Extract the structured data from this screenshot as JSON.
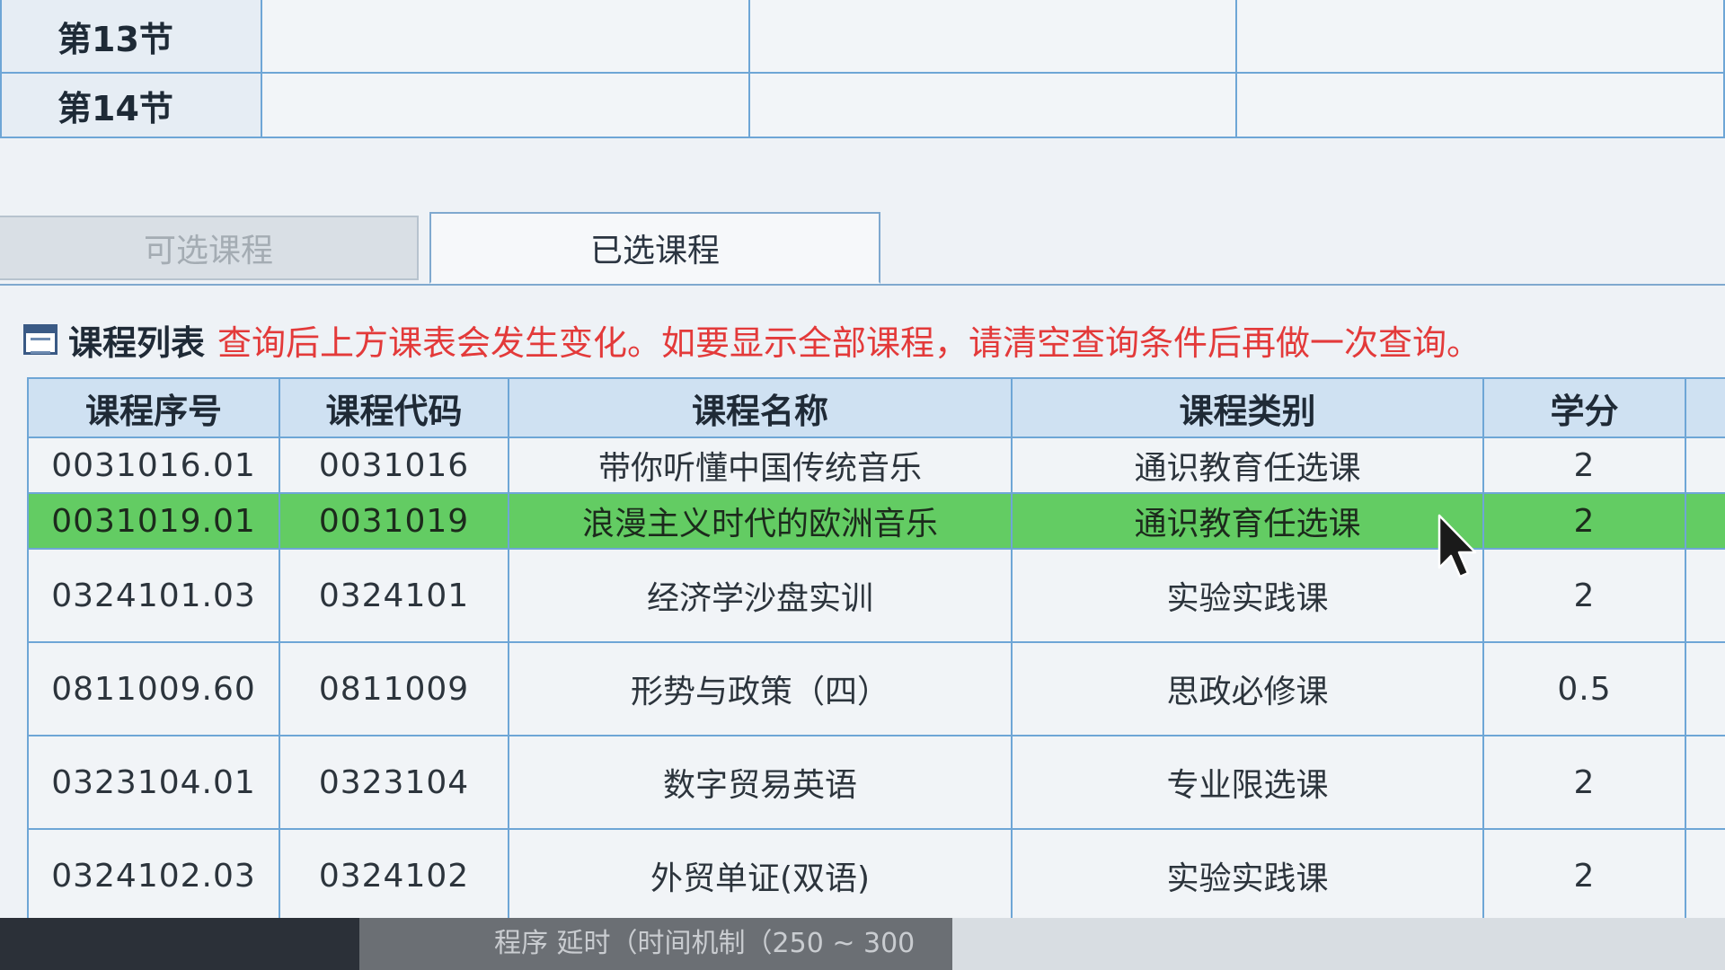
{
  "timetable": {
    "periods": [
      "第13节",
      "第14节"
    ]
  },
  "tabs": {
    "available_label": "可选课程",
    "selected_label": "已选课程"
  },
  "panel": {
    "title": "课程列表",
    "notice": "查询后上方课表会发生变化。如要显示全部课程，请清空查询条件后再做一次查询。"
  },
  "course_table": {
    "headers": {
      "seq": "课程序号",
      "code": "课程代码",
      "name": "课程名称",
      "category": "课程类别",
      "credit": "学分"
    },
    "rows": [
      {
        "seq": "0031016.01",
        "code": "0031016",
        "name": "带你听懂中国传统音乐",
        "category": "通识教育任选课",
        "credit": "2"
      },
      {
        "seq": "0031019.01",
        "code": "0031019",
        "name": "浪漫主义时代的欧洲音乐",
        "category": "通识教育任选课",
        "credit": "2"
      },
      {
        "seq": "0324101.03",
        "code": "0324101",
        "name": "经济学沙盘实训",
        "category": "实验实践课",
        "credit": "2"
      },
      {
        "seq": "0811009.60",
        "code": "0811009",
        "name": "形势与政策（四）",
        "category": "思政必修课",
        "credit": "0.5"
      },
      {
        "seq": "0323104.01",
        "code": "0323104",
        "name": "数字贸易英语",
        "category": "专业限选课",
        "credit": "2"
      },
      {
        "seq": "0324102.03",
        "code": "0324102",
        "name": "外贸单证(双语)",
        "category": "实验实践课",
        "credit": "2"
      }
    ],
    "highlight_color": "#63cc63"
  },
  "status_bar": {
    "text": "程序 延时（时间机制（250 ~ 300"
  }
}
